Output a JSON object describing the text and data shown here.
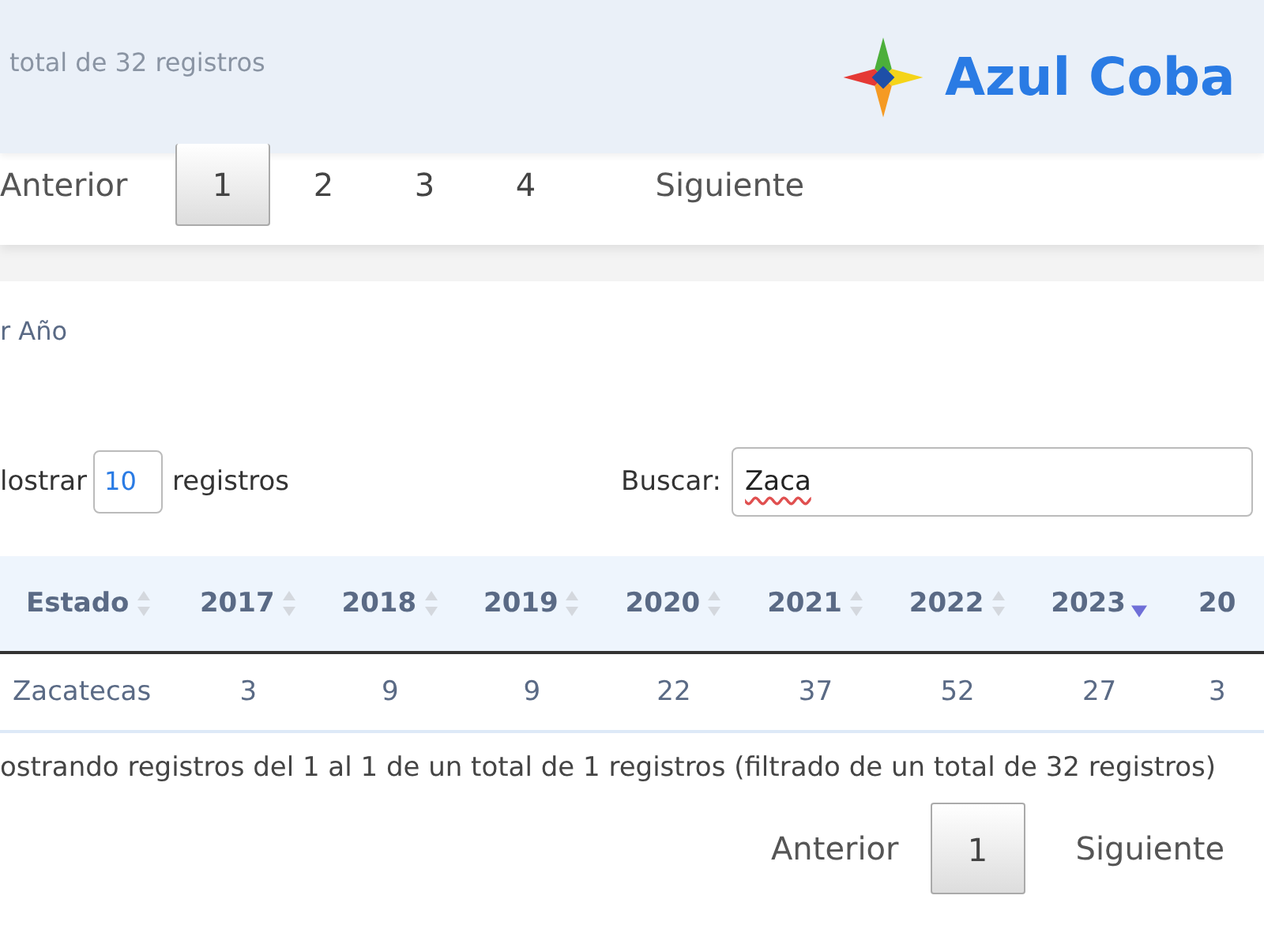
{
  "top_info": "total de 32 registros",
  "top_pagination": {
    "previous": "Anterior",
    "pages": [
      {
        "label": "1",
        "selected": true
      },
      {
        "label": "2",
        "selected": false
      },
      {
        "label": "3",
        "selected": false
      },
      {
        "label": "4",
        "selected": false
      }
    ],
    "next": "Siguiente"
  },
  "header": {
    "brand": "Azul Coba"
  },
  "section_title": "r Año",
  "length_control": {
    "prefix": "lostrar",
    "value": "10",
    "suffix": "registros"
  },
  "search": {
    "label": "Buscar:",
    "value": "Zaca"
  },
  "table": {
    "columns": [
      {
        "label": "Estado",
        "sorted": false
      },
      {
        "label": "2017",
        "sorted": false
      },
      {
        "label": "2018",
        "sorted": false
      },
      {
        "label": "2019",
        "sorted": false
      },
      {
        "label": "2020",
        "sorted": false
      },
      {
        "label": "2021",
        "sorted": false
      },
      {
        "label": "2022",
        "sorted": false
      },
      {
        "label": "2023",
        "sorted": true
      },
      {
        "label": "20"
      }
    ],
    "rows": [
      {
        "cells": [
          "Zacatecas",
          "3",
          "9",
          "9",
          "22",
          "37",
          "52",
          "27",
          "3"
        ]
      }
    ]
  },
  "info": "ostrando registros del 1 al 1 de un total de 1 registros (filtrado de un total de 32 registros)",
  "pagination": {
    "previous": "Anterior",
    "pages": [
      {
        "label": "1",
        "selected": true
      }
    ],
    "next": "Siguiente"
  }
}
